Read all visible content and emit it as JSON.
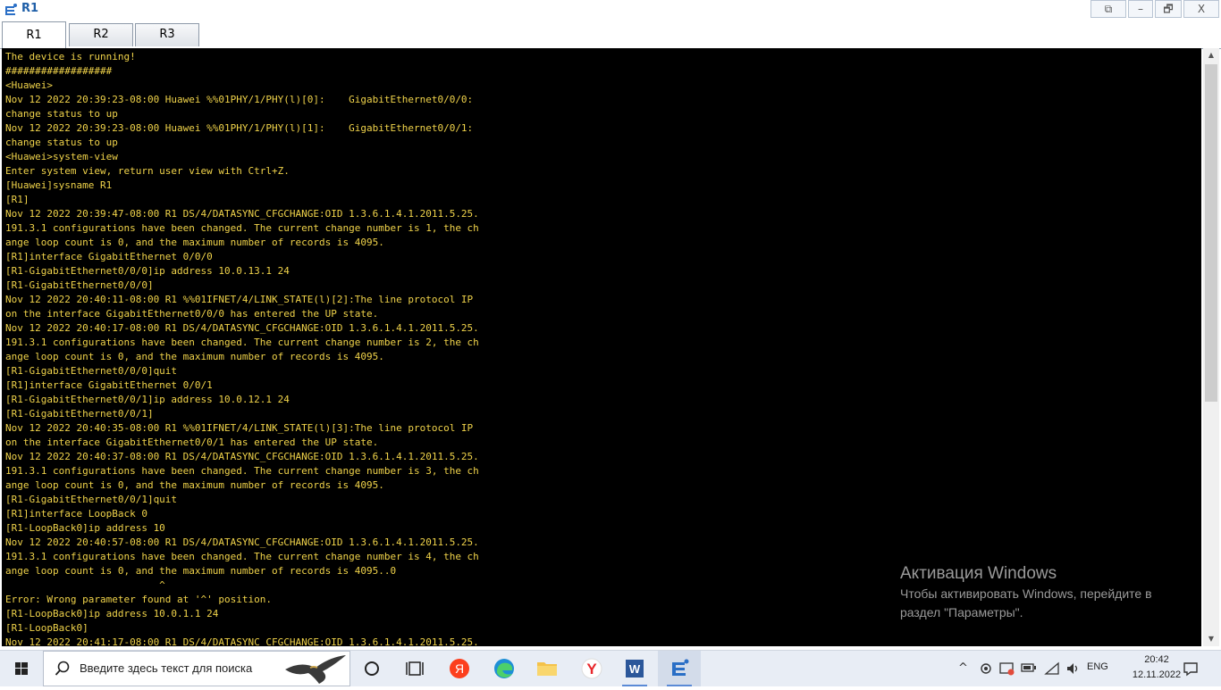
{
  "window": {
    "title": "R1",
    "restore_glyph": "⧉",
    "minimize_glyph": "–",
    "maximize_glyph": "🗗",
    "close_glyph": "X"
  },
  "tabs": [
    {
      "label": "R1",
      "active": true
    },
    {
      "label": "R2",
      "active": false
    },
    {
      "label": "R3",
      "active": false
    }
  ],
  "terminal": {
    "lines": [
      "The device is running!",
      "##################",
      "<Huawei>",
      "Nov 12 2022 20:39:23-08:00 Huawei %%01PHY/1/PHY(l)[0]:    GigabitEthernet0/0/0:",
      "change status to up",
      "Nov 12 2022 20:39:23-08:00 Huawei %%01PHY/1/PHY(l)[1]:    GigabitEthernet0/0/1:",
      "change status to up",
      "<Huawei>system-view",
      "Enter system view, return user view with Ctrl+Z.",
      "[Huawei]sysname R1",
      "[R1]",
      "Nov 12 2022 20:39:47-08:00 R1 DS/4/DATASYNC_CFGCHANGE:OID 1.3.6.1.4.1.2011.5.25.",
      "191.3.1 configurations have been changed. The current change number is 1, the ch",
      "ange loop count is 0, and the maximum number of records is 4095.",
      "[R1]interface GigabitEthernet 0/0/0",
      "[R1-GigabitEthernet0/0/0]ip address 10.0.13.1 24",
      "[R1-GigabitEthernet0/0/0]",
      "Nov 12 2022 20:40:11-08:00 R1 %%01IFNET/4/LINK_STATE(l)[2]:The line protocol IP",
      "on the interface GigabitEthernet0/0/0 has entered the UP state.",
      "Nov 12 2022 20:40:17-08:00 R1 DS/4/DATASYNC_CFGCHANGE:OID 1.3.6.1.4.1.2011.5.25.",
      "191.3.1 configurations have been changed. The current change number is 2, the ch",
      "ange loop count is 0, and the maximum number of records is 4095.",
      "[R1-GigabitEthernet0/0/0]quit",
      "[R1]interface GigabitEthernet 0/0/1",
      "[R1-GigabitEthernet0/0/1]ip address 10.0.12.1 24",
      "[R1-GigabitEthernet0/0/1]",
      "Nov 12 2022 20:40:35-08:00 R1 %%01IFNET/4/LINK_STATE(l)[3]:The line protocol IP",
      "on the interface GigabitEthernet0/0/1 has entered the UP state.",
      "Nov 12 2022 20:40:37-08:00 R1 DS/4/DATASYNC_CFGCHANGE:OID 1.3.6.1.4.1.2011.5.25.",
      "191.3.1 configurations have been changed. The current change number is 3, the ch",
      "ange loop count is 0, and the maximum number of records is 4095.",
      "[R1-GigabitEthernet0/0/1]quit",
      "[R1]interface LoopBack 0",
      "[R1-LoopBack0]ip address 10",
      "Nov 12 2022 20:40:57-08:00 R1 DS/4/DATASYNC_CFGCHANGE:OID 1.3.6.1.4.1.2011.5.25.",
      "191.3.1 configurations have been changed. The current change number is 4, the ch",
      "ange loop count is 0, and the maximum number of records is 4095..0",
      "                          ^",
      "Error: Wrong parameter found at '^' position.",
      "[R1-LoopBack0]ip address 10.0.1.1 24",
      "[R1-LoopBack0]",
      "Nov 12 2022 20:41:17-08:00 R1 DS/4/DATASYNC_CFGCHANGE:OID 1.3.6.1.4.1.2011.5.25."
    ],
    "text_color": "#f0d34a",
    "background": "#000000"
  },
  "scrollbar": {
    "up_glyph": "▲",
    "down_glyph": "▼"
  },
  "watermark": {
    "title": "Активация Windows",
    "line1": "Чтобы активировать Windows, перейдите в",
    "line2": "раздел \"Параметры\"."
  },
  "taskbar": {
    "search_placeholder": "Введите здесь текст для поиска",
    "apps": [
      "cortana-icon",
      "task-view-icon",
      "yandex-browser-icon",
      "edge-icon",
      "file-explorer-icon",
      "yandex-icon",
      "word-icon",
      "ensp-icon"
    ],
    "tray": {
      "chevron": "^",
      "lang": "ENG",
      "time": "20:42",
      "date": "12.11.2022"
    }
  }
}
